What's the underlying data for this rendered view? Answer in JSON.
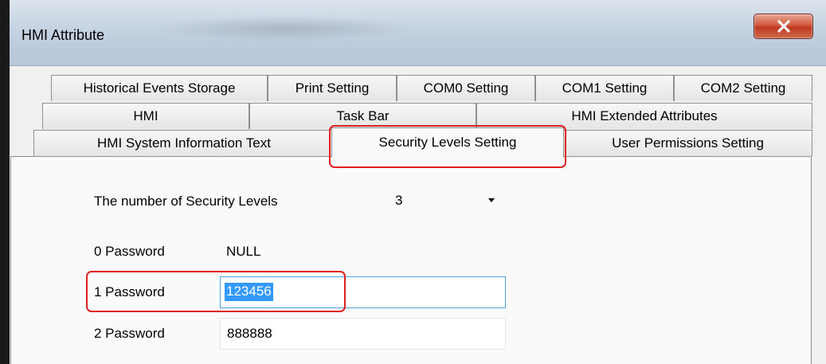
{
  "window": {
    "title": "HMI Attribute"
  },
  "tabs": {
    "row1": [
      "Historical Events Storage",
      "Print Setting",
      "COM0 Setting",
      "COM1 Setting",
      "COM2 Setting"
    ],
    "row2": [
      "HMI",
      "Task Bar",
      "HMI Extended Attributes"
    ],
    "row3": [
      "HMI System Information Text",
      "Security Levels Setting",
      "User Permissions Setting"
    ],
    "selected": "Security Levels Setting"
  },
  "security": {
    "levels_label": "The number of Security Levels",
    "levels_value": "3",
    "pwd0_label": "0 Password",
    "pwd0_value": "NULL",
    "pwd1_label": "1 Password",
    "pwd1_value": "123456",
    "pwd2_label": "2 Password",
    "pwd2_value": "888888"
  },
  "colors": {
    "highlight": "#e02020",
    "selection": "#3399ff",
    "focus_border": "#4fa3e0"
  },
  "icons": {
    "close": "close-icon",
    "dropdown": "chevron-down-icon"
  }
}
